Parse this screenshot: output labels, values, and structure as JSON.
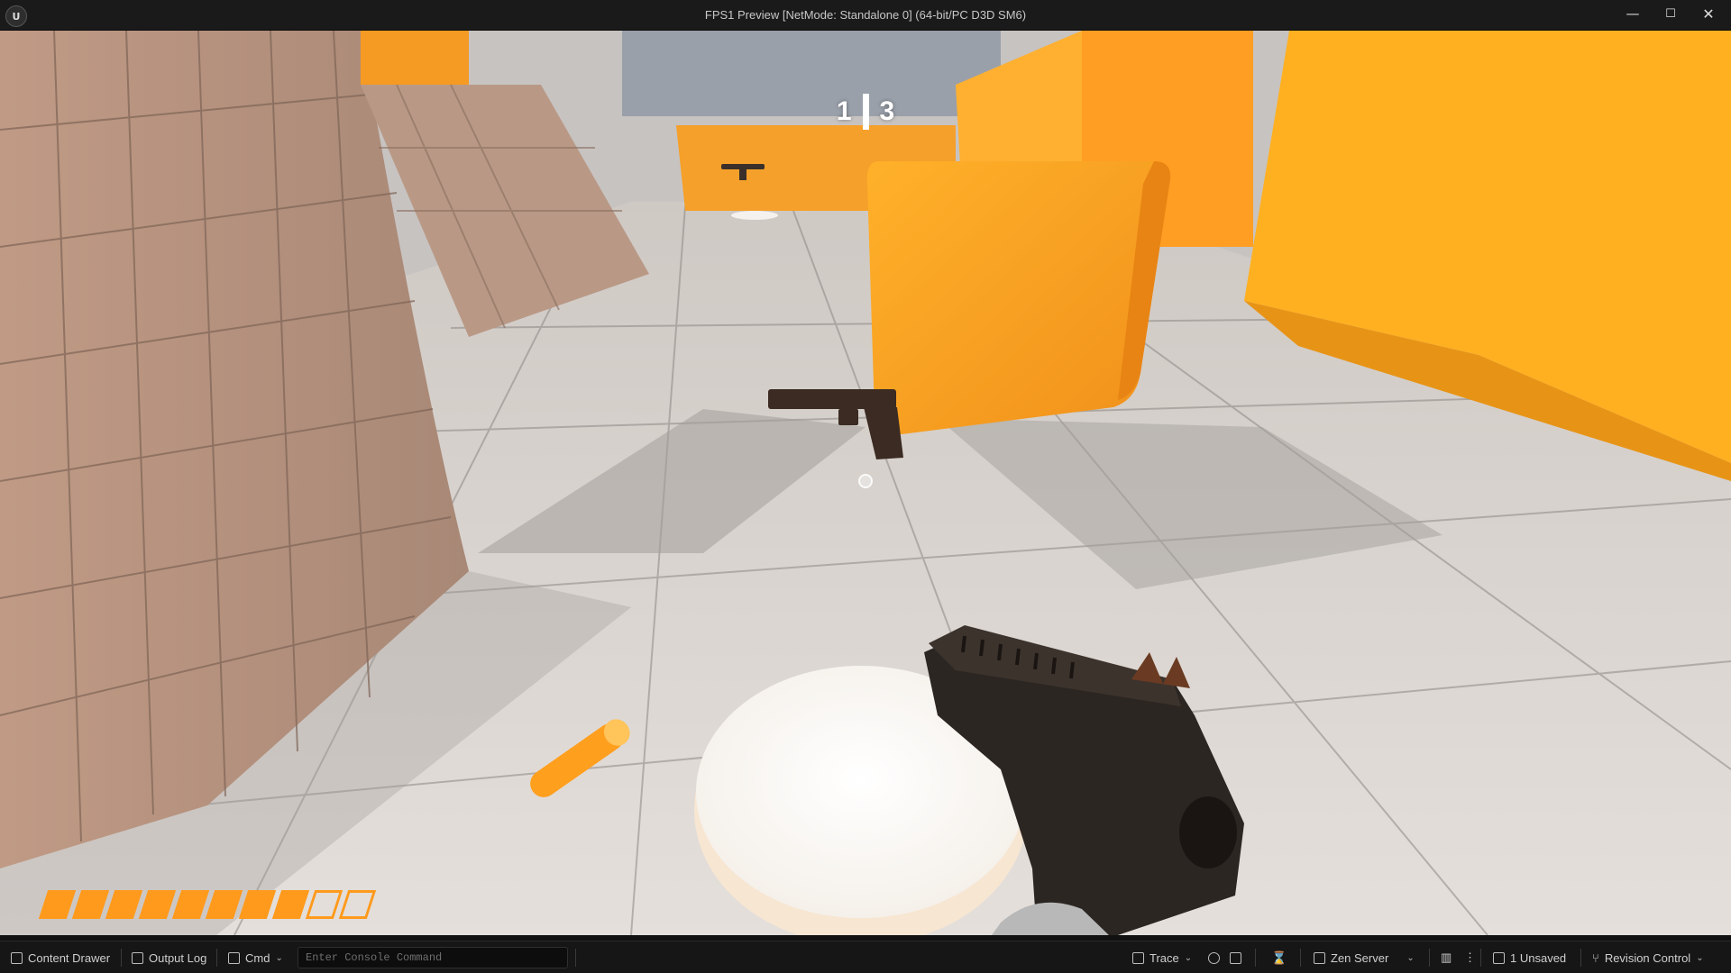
{
  "window": {
    "title": "FPS1 Preview [NetMode: Standalone 0]  (64-bit/PC D3D SM6)",
    "logo_text": "U",
    "min_glyph": "—",
    "max_glyph": "☐",
    "close_glyph": "✕"
  },
  "hud": {
    "score_left": "1",
    "score_right": "3",
    "health": {
      "filled": 8,
      "total": 10
    },
    "accent_color": "#ff9a1c"
  },
  "statusbar": {
    "content_drawer": "Content Drawer",
    "output_log": "Output Log",
    "cmd": "Cmd",
    "console_placeholder": "Enter Console Command",
    "trace": "Trace",
    "zen_server": "Zen Server",
    "unsaved": "1 Unsaved",
    "revision_control": "Revision Control"
  },
  "icons": {
    "content_drawer": "drawer-icon",
    "output_log": "log-icon",
    "cmd": "terminal-icon",
    "trace": "trace-icon",
    "record": "record-icon",
    "camera": "camera-icon",
    "hourglass": "hourglass-icon",
    "zen": "server-icon",
    "stats": "stats-icon",
    "menu": "kebab-icon",
    "unsaved": "save-icon",
    "revision": "branch-icon"
  }
}
